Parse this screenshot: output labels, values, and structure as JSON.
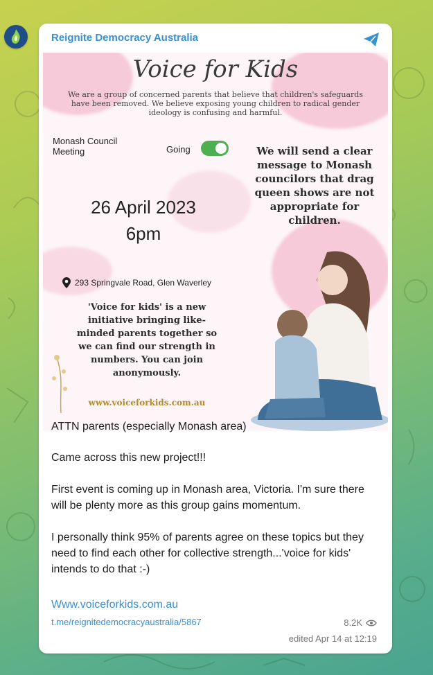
{
  "channel": {
    "name": "Reignite Democracy Australia",
    "icon": "paper-plane-icon"
  },
  "poster": {
    "title": "Voice for Kids",
    "intro": "We are a group of concerned parents that believe that children's safeguards have been removed. We believe exposing young children to radical gender ideology is confusing and harmful.",
    "event_name": "Monash Council Meeting",
    "going_label": "Going",
    "going_on": true,
    "date": "26 April 2023",
    "time": "6pm",
    "message": "We will send a clear message to Monash councilors that drag queen shows are not appropriate for children.",
    "address": "293 Springvale Road, Glen Waverley",
    "initiative": "'Voice for kids' is a new initiative bringing like-minded parents together so we can find our strength in numbers. You can join anonymously.",
    "url": "www.voiceforkids.com.au"
  },
  "message": {
    "line1": "ATTN parents (especially Monash area)",
    "line2": "Came across this new project!!!",
    "line3": "First event is coming up in Monash area, Victoria. I'm sure there will be plenty more as this group gains momentum.",
    "line4": "I personally think 95% of parents agree on these topics but they need to find each other for collective strength...'voice for kids' intends to do that :-)",
    "link": "Www.voiceforkids.com.au",
    "post_link": "t.me/reignitedemocracyaustralia/5867",
    "views": "8.2K",
    "edited": "edited  Apr 14 at 12:19"
  },
  "colors": {
    "link": "#3a8fd1",
    "toggle": "#4caf50"
  }
}
